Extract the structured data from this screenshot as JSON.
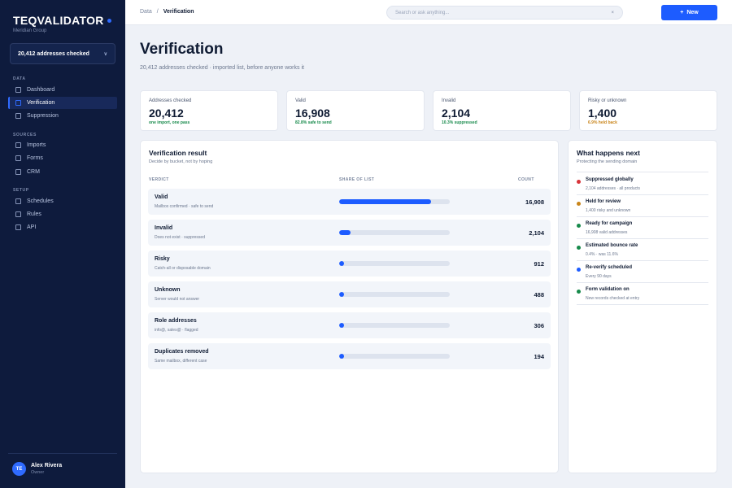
{
  "sidebar": {
    "brand": "TEQVALIDATOR",
    "org": "Meridian Group",
    "scope_selector": "20,412 addresses checked",
    "sections": [
      {
        "title": "DATA",
        "items": [
          "Dashboard",
          "Verification",
          "Suppression"
        ]
      },
      {
        "title": "SOURCES",
        "items": [
          "Imports",
          "Forms",
          "CRM"
        ]
      },
      {
        "title": "SETUP",
        "items": [
          "Schedules",
          "Rules",
          "API"
        ]
      }
    ],
    "active_item": "Verification",
    "user": {
      "initials": "TE",
      "name": "Alex Rivera",
      "role": "Owner"
    }
  },
  "topbar": {
    "breadcrumb": [
      "Data",
      "Verification"
    ],
    "search_placeholder": "Search or ask anything...",
    "clear_icon": "×",
    "new_button": "New"
  },
  "header": {
    "title": "Verification",
    "subtitle": "20,412 addresses checked · imported list, before anyone works it"
  },
  "stats": [
    {
      "label": "Addresses checked",
      "value": "20,412",
      "note": "one import, one pass",
      "note_color": "#178a4b"
    },
    {
      "label": "Valid",
      "value": "16,908",
      "note": "82.8% safe to send",
      "note_color": "#178a4b"
    },
    {
      "label": "Invalid",
      "value": "2,104",
      "note": "10.3% suppressed",
      "note_color": "#178a4b"
    },
    {
      "label": "Risky or unknown",
      "value": "1,400",
      "note": "6.9% held back",
      "note_color": "#c9851a"
    }
  ],
  "result": {
    "title": "Verification result",
    "subtitle": "Decide by bucket, not by hoping",
    "columns": [
      "VERDICT",
      "SHARE OF LIST",
      "COUNT"
    ],
    "rows": [
      {
        "name": "Valid",
        "desc": "Mailbox confirmed · safe to send",
        "count": "16,908",
        "share": 0.83
      },
      {
        "name": "Invalid",
        "desc": "Does not exist · suppressed",
        "count": "2,104",
        "share": 0.103
      },
      {
        "name": "Risky",
        "desc": "Catch-all or disposable domain",
        "count": "912",
        "share": 0.045
      },
      {
        "name": "Unknown",
        "desc": "Server would not answer",
        "count": "488",
        "share": 0.024
      },
      {
        "name": "Role addresses",
        "desc": "info@, sales@ · flagged",
        "count": "306",
        "share": 0.015
      },
      {
        "name": "Duplicates removed",
        "desc": "Same mailbox, different case",
        "count": "194",
        "share": 0.01
      }
    ]
  },
  "next": {
    "title": "What happens next",
    "subtitle": "Protecting the sending domain",
    "items": [
      {
        "title": "Suppressed globally",
        "desc": "2,104 addresses · all products",
        "color": "#d8343a"
      },
      {
        "title": "Held for review",
        "desc": "1,400 risky and unknown",
        "color": "#c9851a"
      },
      {
        "title": "Ready for campaign",
        "desc": "16,908 valid addresses",
        "color": "#178a4b"
      },
      {
        "title": "Estimated bounce rate",
        "desc": "0.4% · was 11.6%",
        "color": "#178a4b"
      },
      {
        "title": "Re-verify scheduled",
        "desc": "Every 90 days",
        "color": "#1d5cff"
      },
      {
        "title": "Form validation on",
        "desc": "New records checked at entry",
        "color": "#178a4b"
      }
    ]
  }
}
